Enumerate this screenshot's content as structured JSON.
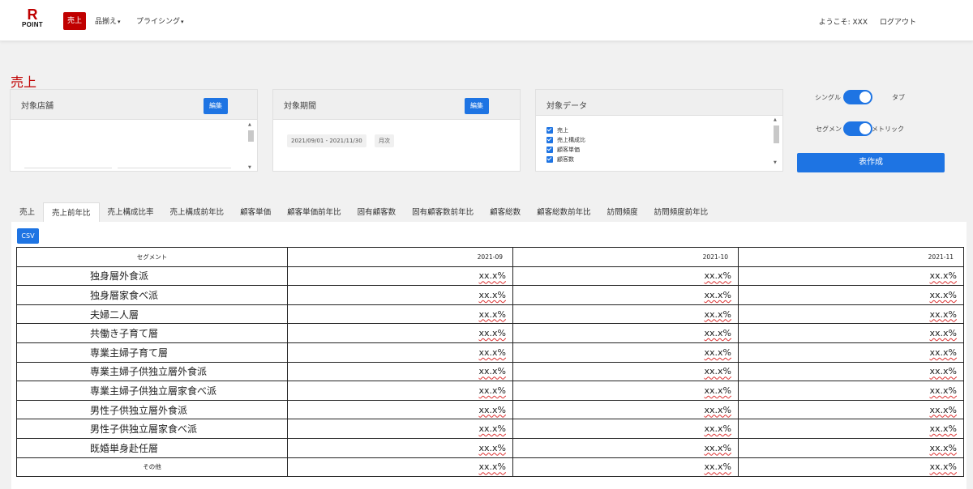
{
  "brand": {
    "line1": "R",
    "line2": "POINT"
  },
  "nav": {
    "active": "売上",
    "items": [
      {
        "label": "品揃え",
        "caret": "▾"
      },
      {
        "label": "プライシング",
        "caret": "▾"
      }
    ],
    "welcome": "ようこそ:  XXX",
    "logout": "ログアウト"
  },
  "page_title": "売上",
  "cards": {
    "store": {
      "title": "対象店舗",
      "edit": "編集"
    },
    "period": {
      "title": "対象期間",
      "edit": "編集",
      "range": "2021/09/01 - 2021/11/30",
      "granularity": "月次"
    },
    "data": {
      "title": "対象データ",
      "items": [
        "売上",
        "売上構成比",
        "顧客単価",
        "顧客数"
      ]
    }
  },
  "toggles": {
    "single": "シングル",
    "tab": "タブ",
    "segment": "セグメン",
    "metric": "メトリック"
  },
  "create_button": "表作成",
  "tabs": [
    "売上",
    "売上前年比",
    "売上構成比率",
    "売上構成前年比",
    "顧客単価",
    "顧客単価前年比",
    "固有顧客数",
    "固有顧客数前年比",
    "顧客総数",
    "顧客総数前年比",
    "訪問頻度",
    "訪問頻度前年比"
  ],
  "active_tab": "売上前年比",
  "csv_button": "CSV",
  "table": {
    "header": {
      "segment": "セグメント",
      "months": [
        "2021-09",
        "2021-10",
        "2021-11"
      ]
    },
    "rows": [
      {
        "name": "独身層外食派",
        "values": [
          "xx.x%",
          "xx.x%",
          "xx.x%"
        ]
      },
      {
        "name": "独身層家食べ派",
        "values": [
          "xx.x%",
          "xx.x%",
          "xx.x%"
        ]
      },
      {
        "name": "夫婦二人層",
        "values": [
          "xx.x%",
          "xx.x%",
          "xx.x%"
        ]
      },
      {
        "name": "共働き子育て層",
        "values": [
          "xx.x%",
          "xx.x%",
          "xx.x%"
        ]
      },
      {
        "name": "専業主婦子育て層",
        "values": [
          "xx.x%",
          "xx.x%",
          "xx.x%"
        ]
      },
      {
        "name": "専業主婦子供独立層外食派",
        "values": [
          "xx.x%",
          "xx.x%",
          "xx.x%"
        ]
      },
      {
        "name": "専業主婦子供独立層家食べ派",
        "values": [
          "xx.x%",
          "xx.x%",
          "xx.x%"
        ]
      },
      {
        "name": "男性子供独立層外食派",
        "values": [
          "xx.x%",
          "xx.x%",
          "xx.x%"
        ]
      },
      {
        "name": "男性子供独立層家食べ派",
        "values": [
          "xx.x%",
          "xx.x%",
          "xx.x%"
        ]
      },
      {
        "name": "既婚単身赴任層",
        "values": [
          "xx.x%",
          "xx.x%",
          "xx.x%"
        ]
      },
      {
        "name": "その他",
        "values": [
          "xx.x%",
          "xx.x%",
          "xx.x%"
        ]
      }
    ]
  }
}
